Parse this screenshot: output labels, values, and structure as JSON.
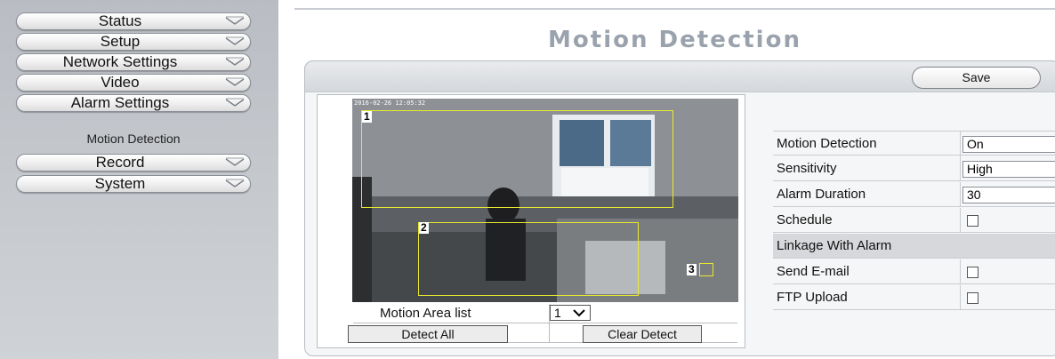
{
  "sidebar": {
    "items": [
      {
        "label": "Status"
      },
      {
        "label": "Setup"
      },
      {
        "label": "Network Settings"
      },
      {
        "label": "Video"
      },
      {
        "label": "Alarm Settings"
      },
      {
        "label": "Record"
      },
      {
        "label": "System"
      }
    ],
    "subitem": "Motion Detection"
  },
  "page": {
    "title": "Motion Detection"
  },
  "toolbar": {
    "save_label": "Save"
  },
  "video": {
    "timestamp": "2016-02-26 12:05:32",
    "zones": [
      "1",
      "2",
      "3"
    ],
    "zone_color": "#e8e830"
  },
  "controls": {
    "area_list_label": "Motion Area list",
    "area_selected": "1",
    "detect_all_label": "Detect All",
    "clear_detect_label": "Clear Detect"
  },
  "settings": {
    "motion_detection": {
      "label": "Motion Detection",
      "value": "On"
    },
    "sensitivity": {
      "label": "Sensitivity",
      "value": "High"
    },
    "alarm_duration": {
      "label": "Alarm Duration",
      "value": "30"
    },
    "schedule": {
      "label": "Schedule",
      "checked": false
    },
    "linkage_header": "Linkage With Alarm",
    "send_email": {
      "label": "Send E-mail",
      "checked": false
    },
    "ftp_upload": {
      "label": "FTP Upload",
      "checked": false
    }
  },
  "colors": {
    "sidebar_bg": "#c3c6cb",
    "title_color": "#9aa3ad"
  }
}
